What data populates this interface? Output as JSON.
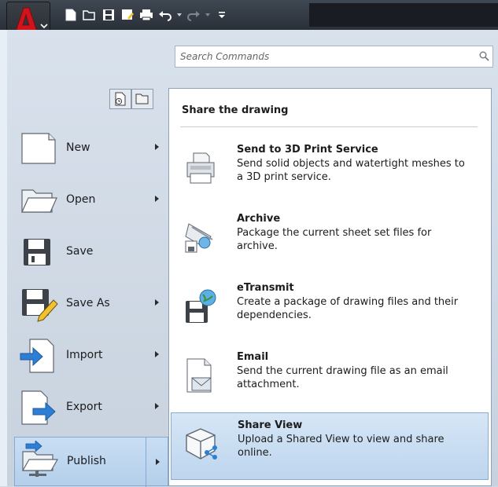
{
  "app": {
    "name": "AutoCAD",
    "accent": "#c4161c"
  },
  "quick_access": {
    "icons": [
      "new-icon",
      "open-icon",
      "save-icon",
      "save-as-icon",
      "plot-icon",
      "undo-icon",
      "redo-icon",
      "customize-icon"
    ]
  },
  "search": {
    "placeholder": "Search Commands"
  },
  "left_menu": {
    "items": [
      {
        "label": "New",
        "icon": "new-document-icon",
        "has_submenu": true
      },
      {
        "label": "Open",
        "icon": "open-folder-icon",
        "has_submenu": true
      },
      {
        "label": "Save",
        "icon": "floppy-disk-icon",
        "has_submenu": false
      },
      {
        "label": "Save As",
        "icon": "save-as-icon",
        "has_submenu": true
      },
      {
        "label": "Import",
        "icon": "import-icon",
        "has_submenu": true
      },
      {
        "label": "Export",
        "icon": "export-icon",
        "has_submenu": true
      },
      {
        "label": "Publish",
        "icon": "publish-icon",
        "has_submenu": true,
        "active": true
      }
    ]
  },
  "panel": {
    "title": "Share the drawing",
    "items": [
      {
        "title": "Send to 3D Print Service",
        "description": "Send solid objects and watertight meshes to a 3D print service.",
        "icon": "3d-printer-icon"
      },
      {
        "title": "Archive",
        "description": "Package the current sheet set files for archive.",
        "icon": "archive-icon"
      },
      {
        "title": "eTransmit",
        "description": "Create a package of drawing files and their dependencies.",
        "icon": "etransmit-icon"
      },
      {
        "title": "Email",
        "description": "Send the current drawing file as an email attachment.",
        "icon": "email-icon"
      },
      {
        "title": "Share View",
        "description": "Upload a Shared View to view and share online.",
        "icon": "share-view-icon",
        "active": true
      }
    ]
  }
}
